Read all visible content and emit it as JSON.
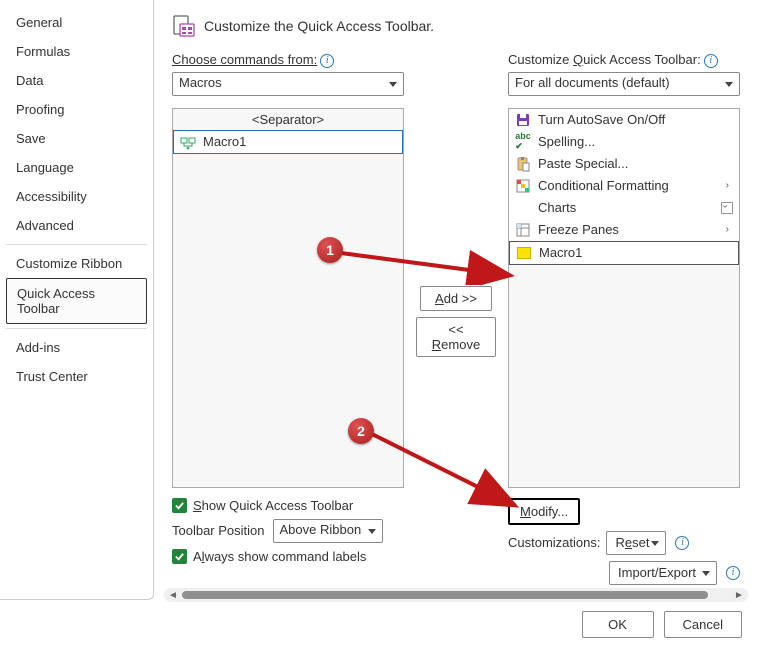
{
  "sidebar": {
    "items": [
      "General",
      "Formulas",
      "Data",
      "Proofing",
      "Save",
      "Language",
      "Accessibility",
      "Advanced",
      "Customize Ribbon",
      "Quick Access Toolbar",
      "Add-ins",
      "Trust Center"
    ],
    "selected": "Quick Access Toolbar"
  },
  "header": {
    "title": "Customize the Quick Access Toolbar."
  },
  "left": {
    "label": "Choose commands from:",
    "dropdown": "Macros",
    "items": [
      {
        "label": "<Separator>",
        "separator": true
      },
      {
        "label": "Macro1",
        "icon": "macro",
        "selected": true
      }
    ]
  },
  "right": {
    "label": "Customize Quick Access Toolbar:",
    "dropdown": "For all documents (default)",
    "items": [
      {
        "label": "Turn AutoSave On/Off",
        "icon": "autosave"
      },
      {
        "label": "Spelling...",
        "icon": "spell"
      },
      {
        "label": "Paste Special...",
        "icon": "paste"
      },
      {
        "label": "Conditional Formatting",
        "icon": "cond",
        "chev": ">"
      },
      {
        "label": "Charts",
        "icon": "",
        "chev": "box"
      },
      {
        "label": "Freeze Panes",
        "icon": "freeze",
        "chev": ">"
      },
      {
        "label": "Macro1",
        "icon": "yellow",
        "selected": true
      }
    ]
  },
  "mid": {
    "add": "Add >>",
    "remove": "<< Remove"
  },
  "belowLeft": {
    "showQat": "Show Quick Access Toolbar",
    "posLabel": "Toolbar Position",
    "posValue": "Above Ribbon",
    "alwaysShow": "Always show command labels"
  },
  "belowRight": {
    "modify": "Modify...",
    "custLabel": "Customizations:",
    "reset": "Reset",
    "impexp": "Import/Export"
  },
  "footer": {
    "ok": "OK",
    "cancel": "Cancel"
  },
  "callouts": {
    "c1": "1",
    "c2": "2"
  }
}
